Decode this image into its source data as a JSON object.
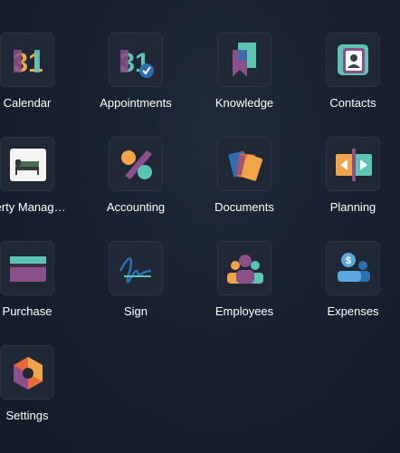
{
  "apps": [
    {
      "label": "Calendar",
      "icon": "calendar-icon"
    },
    {
      "label": "Appointments",
      "icon": "appointments-icon"
    },
    {
      "label": "Knowledge",
      "icon": "knowledge-icon"
    },
    {
      "label": "Contacts",
      "icon": "contacts-icon"
    },
    {
      "label": "perty Manag…",
      "icon": "property-management-icon"
    },
    {
      "label": "Accounting",
      "icon": "accounting-icon"
    },
    {
      "label": "Documents",
      "icon": "documents-icon"
    },
    {
      "label": "Planning",
      "icon": "planning-icon"
    },
    {
      "label": "Purchase",
      "icon": "purchase-icon"
    },
    {
      "label": "Sign",
      "icon": "sign-icon"
    },
    {
      "label": "Employees",
      "icon": "employees-icon"
    },
    {
      "label": "Expenses",
      "icon": "expenses-icon"
    },
    {
      "label": "Settings",
      "icon": "settings-icon"
    }
  ],
  "calendar_icon_text": "31",
  "appointments_icon_text": "31",
  "colors": {
    "background": "#172130",
    "tile_background": "#212836",
    "teal": "#5cc4b2",
    "purple": "#8b4f8a",
    "orange": "#f1a54a",
    "blue": "#2d6fb0"
  }
}
